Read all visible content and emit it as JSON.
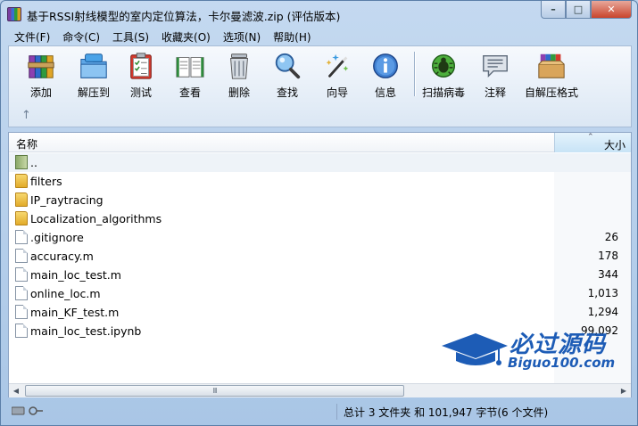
{
  "window": {
    "title": "基于RSSI射线模型的室内定位算法，卡尔曼滤波.zip (评估版本)",
    "controls": {
      "minimize": "–",
      "maximize": "□",
      "close": "✕"
    }
  },
  "menu": [
    {
      "label": "文件(F)"
    },
    {
      "label": "命令(C)"
    },
    {
      "label": "工具(S)"
    },
    {
      "label": "收藏夹(O)"
    },
    {
      "label": "选项(N)"
    },
    {
      "label": "帮助(H)"
    }
  ],
  "toolbar": {
    "tools": [
      {
        "label": "添加",
        "icon": "add-archive-icon"
      },
      {
        "label": "解压到",
        "icon": "extract-folder-icon"
      },
      {
        "label": "测试",
        "icon": "test-clipboard-icon"
      },
      {
        "label": "查看",
        "icon": "view-book-icon"
      },
      {
        "label": "删除",
        "icon": "trash-icon"
      },
      {
        "label": "查找",
        "icon": "magnifier-icon"
      },
      {
        "label": "向导",
        "icon": "wizard-wand-icon"
      },
      {
        "label": "信息",
        "icon": "info-icon"
      },
      {
        "label": "扫描病毒",
        "icon": "virus-scan-icon"
      },
      {
        "label": "注释",
        "icon": "comment-icon"
      },
      {
        "label": "自解压格式",
        "icon": "sfx-box-icon"
      }
    ],
    "up_glyph": "↑"
  },
  "filelist": {
    "columns": {
      "name": "名称",
      "size": "大小",
      "sort_glyph": "⌃"
    },
    "rows": [
      {
        "name": "..",
        "size": "",
        "type": "updir"
      },
      {
        "name": "filters",
        "size": "",
        "type": "folder"
      },
      {
        "name": "IP_raytracing",
        "size": "",
        "type": "folder"
      },
      {
        "name": "Localization_algorithms",
        "size": "",
        "type": "folder"
      },
      {
        "name": ".gitignore",
        "size": "26",
        "type": "file"
      },
      {
        "name": "accuracy.m",
        "size": "178",
        "type": "file"
      },
      {
        "name": "main_loc_test.m",
        "size": "344",
        "type": "file"
      },
      {
        "name": "online_loc.m",
        "size": "1,013",
        "type": "file"
      },
      {
        "name": "main_KF_test.m",
        "size": "1,294",
        "type": "file"
      },
      {
        "name": "main_loc_test.ipynb",
        "size": "99,092",
        "type": "file"
      }
    ],
    "scrollbar": {
      "left": "◀",
      "right": "▶",
      "grip": "III"
    }
  },
  "status": {
    "summary": "总计 3 文件夹 和 101,947 字节(6 个文件)"
  },
  "watermark": {
    "cn": "必过源码",
    "en": "Biguo100.com"
  },
  "colors": {
    "accent": "#1d5cb6",
    "title_bg": "#c4d9f0",
    "toolbar_bg": "#dbe7f4"
  }
}
